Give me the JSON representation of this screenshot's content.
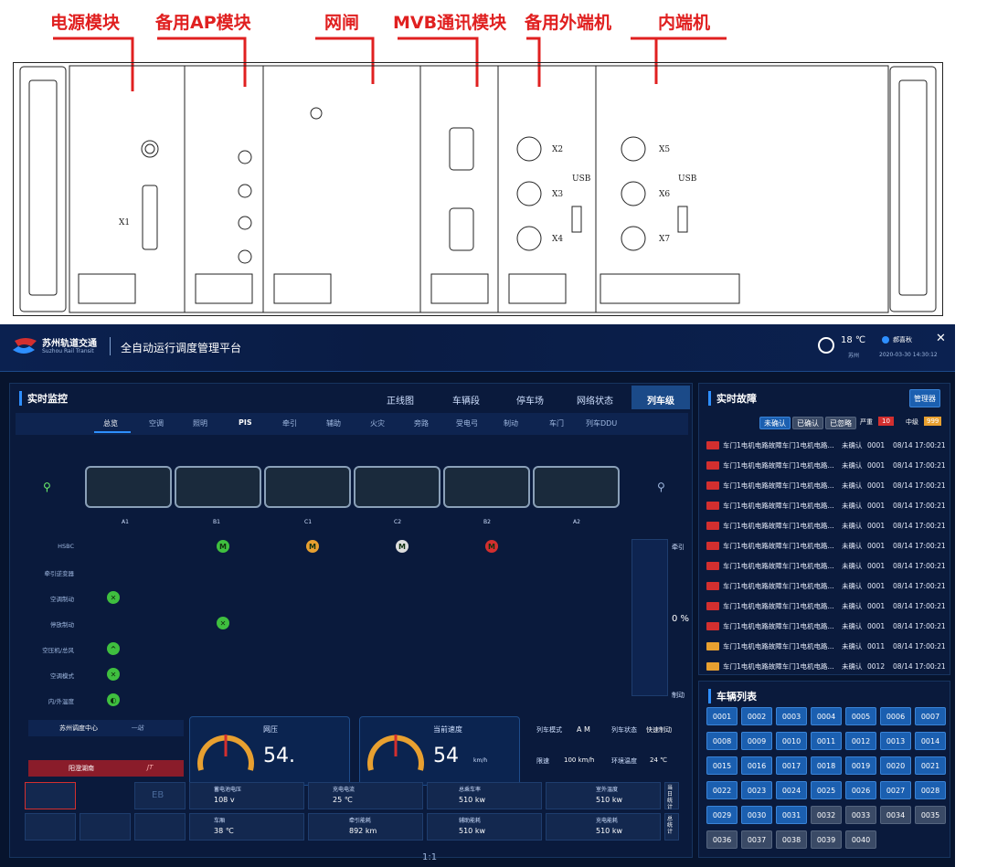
{
  "labels": {
    "power": "电源模块",
    "backup_ap": "备用AP模块",
    "gateway": "网闸",
    "mvb": "MVB通讯模块",
    "backup_ext": "备用外端机",
    "internal": "内端机"
  },
  "rack": {
    "x1": "X1",
    "x2": "X2",
    "x3": "X3",
    "x4": "X4",
    "x5": "X5",
    "x6": "X6",
    "x7": "X7",
    "usb1": "USB",
    "usb2": "USB"
  },
  "header": {
    "brand_cn": "苏州轨道交通",
    "brand_en": "Suzhou Rail Transit",
    "title": "全自动运行调度管理平台",
    "temp": "18 ℃",
    "city": "苏州",
    "user": "郝喜秋",
    "datetime": "2020-03-30  14:30:12",
    "close": "✕"
  },
  "monitor": {
    "title": "实时监控",
    "nav": [
      "正线图",
      "车辆段",
      "停车场",
      "网络状态",
      "列车级"
    ],
    "subtabs": [
      "总览",
      "空调",
      "照明",
      "PIS",
      "牵引",
      "辅助",
      "火灾",
      "旁路",
      "受电弓",
      "制动",
      "车门",
      "列车DDU"
    ],
    "cars": [
      "A1",
      "B1",
      "C1",
      "C2",
      "B2",
      "A2"
    ],
    "rows": [
      "HSBC",
      "牵引逆变器",
      "空调制动",
      "停放制动",
      "空压机/总风",
      "空调模式",
      "内/外温度"
    ],
    "percent": "0 %",
    "side_top": "牵引",
    "side_bottom": "制动"
  },
  "bottom": {
    "center": "苏州调度中心",
    "station": "阳澄湖南",
    "speed_a": "一站",
    "speed_b": "JT",
    "gauge1_label": "网压",
    "gauge1_value": "54.",
    "gauge2_label": "当前速度",
    "gauge2_value": "54",
    "gauge2_unit": "km/h",
    "mode_label": "列车模式",
    "mode_value": "A M",
    "state_label": "列车状态",
    "state_value": "快速制动",
    "limit_label": "限速",
    "limit_value": "100 km/h",
    "env_label": "环境温度",
    "env_value": "24 ℃",
    "stats": [
      {
        "label": "蓄电池电压",
        "value": "108 v"
      },
      {
        "label": "充电电流",
        "value": "25 ℃"
      },
      {
        "label": "总乘车率",
        "value": "510 kw"
      },
      {
        "label": "室外温度",
        "value": "510 kw"
      },
      {
        "label": "车厢",
        "value": "38 ℃"
      },
      {
        "label": "牵引能耗",
        "value": "892 km"
      },
      {
        "label": "辅助能耗",
        "value": "510 kw"
      },
      {
        "label": "充电能耗",
        "value": "510 kw"
      }
    ],
    "eb": "EB",
    "side1": "当日统计",
    "side2": "总统计"
  },
  "faults": {
    "title": "实时故障",
    "manage": "管理器",
    "filters": [
      "未确认",
      "已确认",
      "已忽略"
    ],
    "sev_label1": "严重",
    "sev_count1": "10",
    "sev_label2": "中级",
    "sev_count2": "999",
    "items": [
      {
        "text": "车门1电机电路故障车门1电机电路...",
        "state": "未确认",
        "code": "0001",
        "time": "08/14  17:00:21",
        "level": "严重"
      },
      {
        "text": "车门1电机电路故障车门1电机电路...",
        "state": "未确认",
        "code": "0001",
        "time": "08/14  17:00:21",
        "level": "严重"
      },
      {
        "text": "车门1电机电路故障车门1电机电路...",
        "state": "未确认",
        "code": "0001",
        "time": "08/14  17:00:21",
        "level": "严重"
      },
      {
        "text": "车门1电机电路故障车门1电机电路...",
        "state": "未确认",
        "code": "0001",
        "time": "08/14  17:00:21",
        "level": "严重"
      },
      {
        "text": "车门1电机电路故障车门1电机电路...",
        "state": "未确认",
        "code": "0001",
        "time": "08/14  17:00:21",
        "level": "严重"
      },
      {
        "text": "车门1电机电路故障车门1电机电路...",
        "state": "未确认",
        "code": "0001",
        "time": "08/14  17:00:21",
        "level": "严重"
      },
      {
        "text": "车门1电机电路故障车门1电机电路...",
        "state": "未确认",
        "code": "0001",
        "time": "08/14  17:00:21",
        "level": "严重"
      },
      {
        "text": "车门1电机电路故障车门1电机电路...",
        "state": "未确认",
        "code": "0001",
        "time": "08/14  17:00:21",
        "level": "严重"
      },
      {
        "text": "车门1电机电路故障车门1电机电路...",
        "state": "未确认",
        "code": "0001",
        "time": "08/14  17:00:21",
        "level": "严重"
      },
      {
        "text": "车门1电机电路故障车门1电机电路...",
        "state": "未确认",
        "code": "0001",
        "time": "08/14  17:00:21",
        "level": "严重"
      },
      {
        "text": "车门1电机电路故障车门1电机电路...",
        "state": "未确认",
        "code": "0011",
        "time": "08/14  17:00:21",
        "level": "中级"
      },
      {
        "text": "车门1电机电路故障车门1电机电路...",
        "state": "未确认",
        "code": "0012",
        "time": "08/14  17:00:21",
        "level": "中级"
      }
    ]
  },
  "vehicles": {
    "title": "车辆列表",
    "ids": [
      "0001",
      "0002",
      "0003",
      "0004",
      "0005",
      "0006",
      "0007",
      "0008",
      "0009",
      "0010",
      "0011",
      "0012",
      "0013",
      "0014",
      "0015",
      "0016",
      "0017",
      "0018",
      "0019",
      "0020",
      "0021",
      "0022",
      "0023",
      "0024",
      "0025",
      "0026",
      "0027",
      "0028",
      "0029",
      "0030",
      "0031",
      "0032",
      "0033",
      "0034",
      "0035",
      "0036",
      "0037",
      "0038",
      "0039",
      "0040"
    ],
    "gray_from": 31
  },
  "footer": {
    "zoom": "1:1"
  },
  "colors": {
    "bg": "#07142e",
    "accent": "#2e8fff",
    "ok": "#3fbf3f",
    "alarm": "#d32f2f",
    "warn": "#e8a030"
  }
}
